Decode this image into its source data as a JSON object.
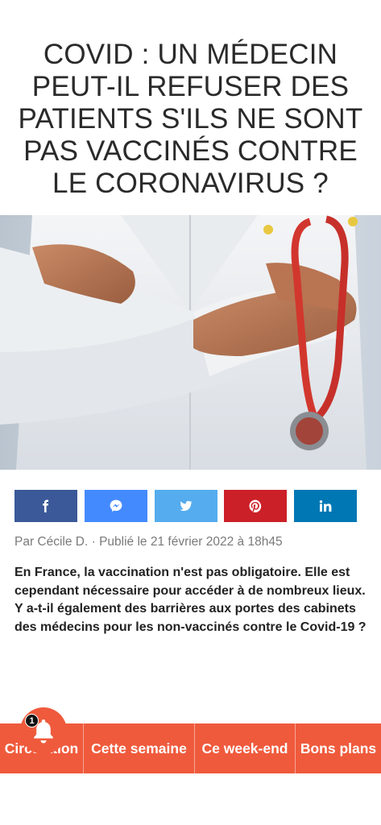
{
  "article": {
    "title": "COVID : UN MÉDECIN PEUT-IL REFUSER DES PATIENTS S'ILS NE SONT PAS VACCINÉS CONTRE LE CORONAVIRUS ?",
    "byline": "Par Cécile D. · Publié le 21 février 2022 à 18h45",
    "intro": "En France, la vaccination n'est pas obligatoire. Elle est cependant nécessaire pour accéder à de nombreux lieux. Y a-t-il également des barrières aux portes des cabinets des médecins pour les non-vaccinés contre le Covid-19 ?"
  },
  "share": {
    "buttons": [
      {
        "icon": "facebook-icon",
        "color": "#3b5998"
      },
      {
        "icon": "messenger-icon",
        "color": "#448aff"
      },
      {
        "icon": "twitter-icon",
        "color": "#55acee"
      },
      {
        "icon": "pinterest-icon",
        "color": "#cb2027"
      },
      {
        "icon": "linkedin-icon",
        "color": "#0077b5"
      }
    ]
  },
  "nav": {
    "items": [
      "Circulation",
      "Cette semaine",
      "Ce week-end",
      "Bons plans"
    ]
  },
  "notification": {
    "icon": "bell-icon",
    "count": "1"
  },
  "colors": {
    "accent": "#ef5a3c"
  }
}
